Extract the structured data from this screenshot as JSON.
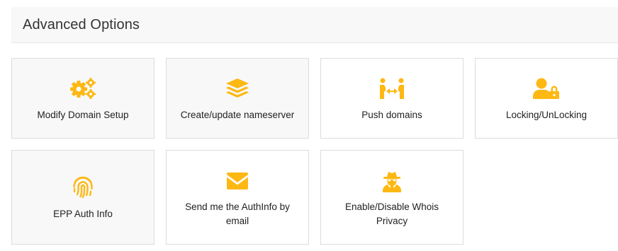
{
  "section": {
    "title": "Advanced Options"
  },
  "colors": {
    "accent": "#fdb813",
    "border": "#dcdcdc",
    "shaded": "#f8f8f8"
  },
  "options": [
    {
      "label": "Modify Domain Setup",
      "icon": "gears-icon"
    },
    {
      "label": "Create/update nameserver",
      "icon": "layers-icon"
    },
    {
      "label": "Push domains",
      "icon": "people-arrows-icon"
    },
    {
      "label": "Locking/UnLocking",
      "icon": "user-lock-icon"
    },
    {
      "label": "EPP Auth Info",
      "icon": "fingerprint-icon"
    },
    {
      "label": "Send me the AuthInfo by email",
      "icon": "envelope-icon"
    },
    {
      "label": "Enable/Disable Whois Privacy",
      "icon": "user-secret-icon"
    }
  ]
}
